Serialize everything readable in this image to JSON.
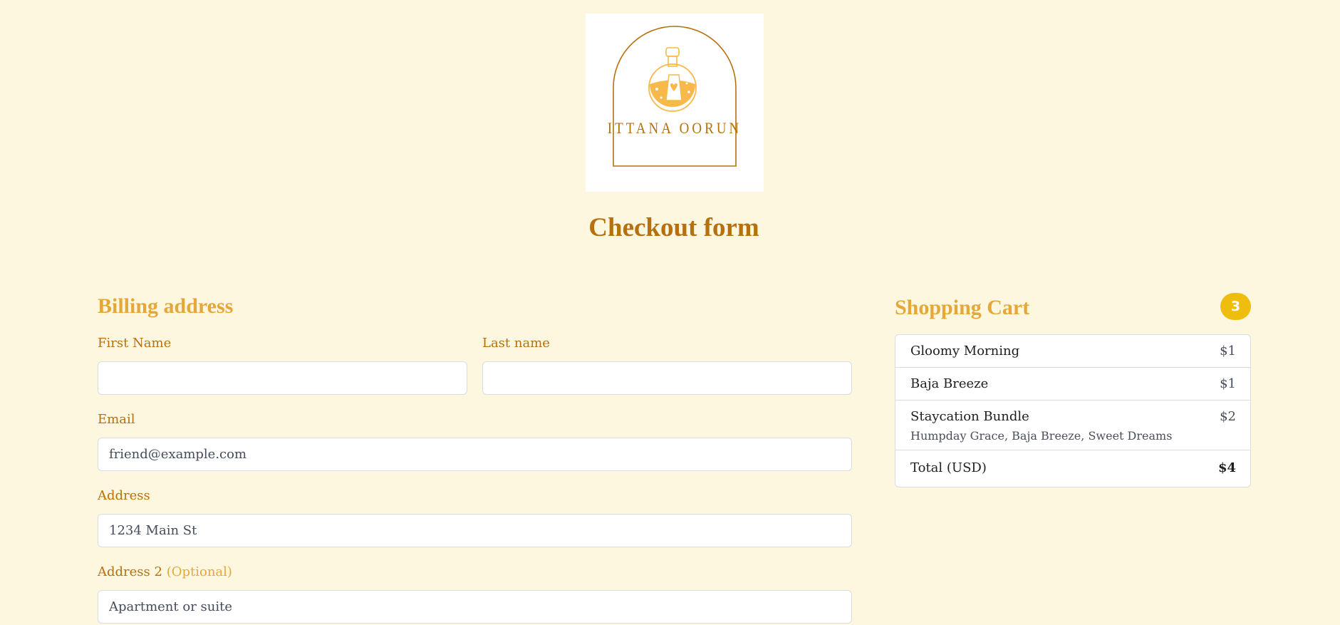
{
  "brand": {
    "logo_text": "ITTANA OORUN",
    "color": "#b6700e",
    "accent": "#f7b949"
  },
  "page": {
    "title": "Checkout form"
  },
  "billing": {
    "title": "Billing address",
    "first_name": {
      "label": "First Name",
      "placeholder": ""
    },
    "last_name": {
      "label": "Last name",
      "placeholder": ""
    },
    "email": {
      "label": "Email",
      "placeholder": "friend@example.com"
    },
    "address": {
      "label": "Address",
      "placeholder": "1234 Main St"
    },
    "address2": {
      "label": "Address 2",
      "optional": "(Optional)",
      "placeholder": "Apartment or suite"
    }
  },
  "cart": {
    "title": "Shopping Cart",
    "count": "3",
    "items": [
      {
        "name": "Gloomy Morning",
        "price": "$1"
      },
      {
        "name": "Baja Breeze",
        "price": "$1"
      },
      {
        "name": "Staycation Bundle",
        "price": "$2",
        "contents": "Humpday Grace, Baja Breeze, Sweet Dreams"
      }
    ],
    "total": {
      "label": "Total (USD)",
      "value": "$4"
    }
  }
}
